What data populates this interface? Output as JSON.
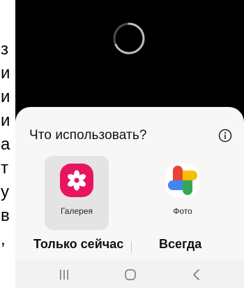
{
  "background": {
    "letters": [
      "з",
      "и",
      "и",
      "и",
      "а",
      "т",
      "у",
      "в",
      ","
    ]
  },
  "sheet": {
    "title": "Что использовать?",
    "apps": [
      {
        "label": "Галерея",
        "icon": "gallery-flower-icon",
        "selected": true
      },
      {
        "label": "Фото",
        "icon": "google-photos-pinwheel-icon",
        "selected": false
      }
    ],
    "just_once_label": "Только сейчас",
    "always_label": "Всегда"
  },
  "navbar": {
    "recents_icon": "recents-lines-icon",
    "home_icon": "home-rounded-square-icon",
    "back_icon": "back-chevron-icon"
  },
  "colors": {
    "gallery": "#e8145f",
    "photos_red": "#ea4335",
    "photos_yellow": "#fbbc04",
    "photos_green": "#34a853",
    "photos_blue": "#4285f4"
  }
}
